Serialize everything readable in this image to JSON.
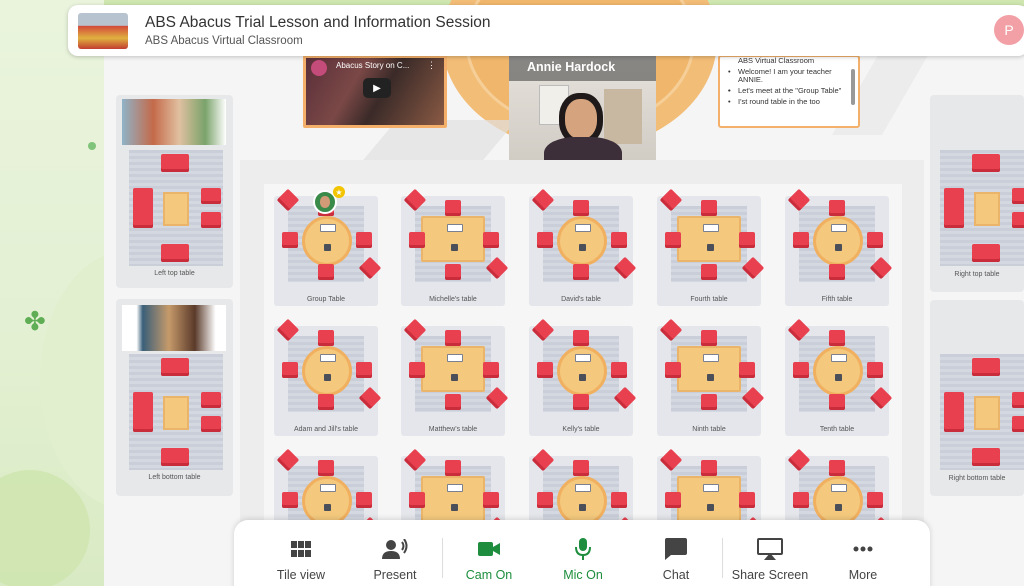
{
  "header": {
    "title": "ABS Abacus Trial Lesson and Information Session",
    "subtitle": "ABS Abacus Virtual Classroom"
  },
  "stage": {
    "video_title": "Abacus Story on C...",
    "presenter_name": "Annie Hardock",
    "chat_note_heading": "ABS Virtual Classroom",
    "chat_note_lines": [
      "Welcome! I am your teacher ANNIE.",
      "",
      "Let's meet at the \"Group Table\"",
      "I'st round table in the too"
    ]
  },
  "side_tables": {
    "left_top": "Left top table",
    "left_bottom": "Left bottom table",
    "right_top": "Right top table",
    "right_bottom": "Right bottom table"
  },
  "tables": [
    "Group Table",
    "Michelle's table",
    "David's table",
    "Fourth table",
    "Fifth table",
    "Adam and Jill's table",
    "Matthew's table",
    "Kelly's table",
    "Ninth table",
    "Tenth table"
  ],
  "toolbar": {
    "tile_view": "Tile view",
    "present": "Present",
    "cam_on": "Cam On",
    "mic_on": "Mic On",
    "chat": "Chat",
    "share_screen": "Share Screen",
    "more": "More"
  },
  "colors": {
    "accent_green": "#1e8e3e",
    "chair_red": "#e8404f",
    "table_orange": "#f4c97d"
  }
}
